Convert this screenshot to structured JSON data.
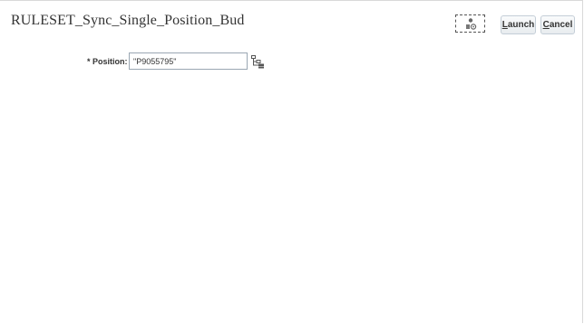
{
  "dialog": {
    "title": "RULESET_Sync_Single_Position_Bud"
  },
  "toolbar": {
    "options_icon": "member-selector-icon",
    "launch": {
      "access_key": "L",
      "rest": "aunch"
    },
    "cancel": {
      "access_key": "C",
      "rest": "ancel"
    }
  },
  "form": {
    "position": {
      "label": "* Position:",
      "value": "\"P9055795\"",
      "selector_icon": "hierarchy-tree-icon"
    }
  }
}
